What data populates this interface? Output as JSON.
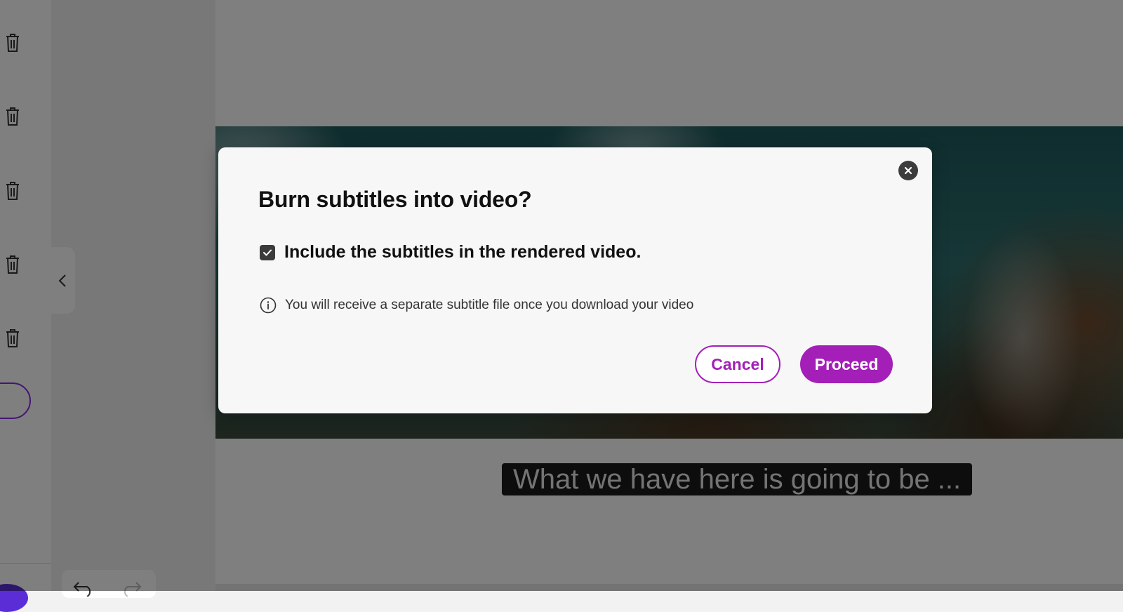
{
  "dialog": {
    "title": "Burn subtitles into video?",
    "checkbox_label": "Include the subtitles in the rendered video.",
    "checkbox_checked": true,
    "info_text": "You will receive a separate subtitle file once you download your video",
    "cancel_label": "Cancel",
    "proceed_label": "Proceed",
    "accent_color": "#a31fb8"
  },
  "preview": {
    "subtitle_text": "What we have here is going to be ..."
  },
  "icons": {
    "close": "close-icon",
    "check": "checkmark-icon",
    "info": "info-icon",
    "trash": "trash-icon",
    "chevron": "chevron-left-icon",
    "undo": "undo-icon",
    "redo": "redo-icon"
  }
}
